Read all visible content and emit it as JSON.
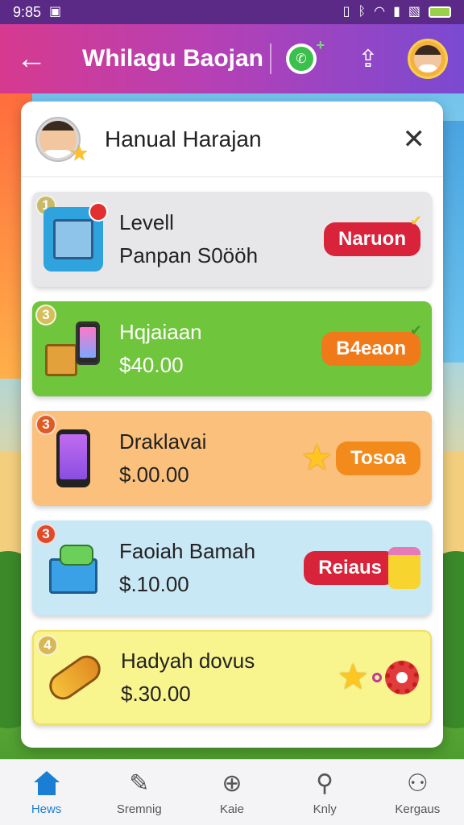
{
  "status_bar": {
    "time": "9:85",
    "colors": {
      "bar": "#5b2a86"
    }
  },
  "header": {
    "back_icon": "arrow-left-icon",
    "title": "Whilagu Baojan",
    "whatsapp_icon": "whatsapp-icon",
    "share_icon": "share-icon",
    "avatar_icon": "profile-avatar-icon"
  },
  "card": {
    "title": "Hanual Harajan",
    "close_icon": "close-icon",
    "items": [
      {
        "num": "1",
        "name": "Levell",
        "price": "Panpan S0ööh",
        "action": "Naruon",
        "action_color": "#d9233a",
        "action_check": "✔"
      },
      {
        "num": "3",
        "name": "Hqjaiaan",
        "price": "$40.00",
        "action": "B4eaon",
        "action_color": "#f07a1a",
        "action_check": "✔"
      },
      {
        "num": "3",
        "name": "Draklavai",
        "price": "$.00.00",
        "action": "Tosoa",
        "action_color": "#f28a1c",
        "action_check": ""
      },
      {
        "num": "3",
        "name": "Faoiah Bamah",
        "price": "$.10.00",
        "action": "Reiaus",
        "action_color": "#d9233a",
        "action_check": ""
      },
      {
        "num": "4",
        "name": "Hadyah dovus",
        "price": "$.30.00",
        "action": "",
        "action_color": "",
        "action_check": ""
      }
    ]
  },
  "bottom_nav": {
    "items": [
      {
        "label": "Hews",
        "icon": "home-icon",
        "active": true
      },
      {
        "label": "Sremnig",
        "icon": "edit-icon",
        "active": false
      },
      {
        "label": "Kaie",
        "icon": "add-circle-icon",
        "active": false
      },
      {
        "label": "Knly",
        "icon": "search-icon",
        "active": false
      },
      {
        "label": "Kergaus",
        "icon": "user-icon",
        "active": false
      }
    ]
  }
}
